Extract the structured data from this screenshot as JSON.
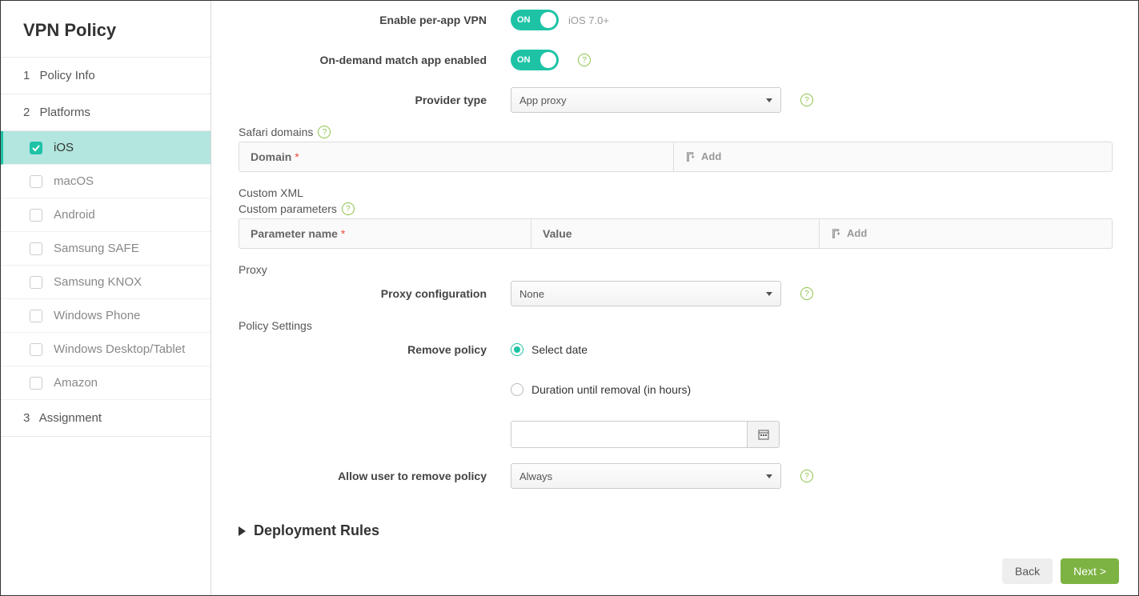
{
  "sidebar": {
    "title": "VPN Policy",
    "steps": [
      {
        "num": "1",
        "label": "Policy Info"
      },
      {
        "num": "2",
        "label": "Platforms"
      },
      {
        "num": "3",
        "label": "Assignment"
      }
    ],
    "platforms": [
      {
        "label": "iOS",
        "active": true
      },
      {
        "label": "macOS",
        "active": false
      },
      {
        "label": "Android",
        "active": false
      },
      {
        "label": "Samsung SAFE",
        "active": false
      },
      {
        "label": "Samsung KNOX",
        "active": false
      },
      {
        "label": "Windows Phone",
        "active": false
      },
      {
        "label": "Windows Desktop/Tablet",
        "active": false
      },
      {
        "label": "Amazon",
        "active": false
      }
    ]
  },
  "form": {
    "enable_per_app_vpn": {
      "label": "Enable per-app VPN",
      "toggle": "ON",
      "hint": "iOS 7.0+"
    },
    "on_demand_match": {
      "label": "On-demand match app enabled",
      "toggle": "ON"
    },
    "provider_type": {
      "label": "Provider type",
      "value": "App proxy"
    },
    "safari_domains": {
      "label": "Safari domains",
      "col_domain": "Domain",
      "add": "Add"
    },
    "custom_xml": {
      "label": "Custom XML"
    },
    "custom_params": {
      "label": "Custom parameters",
      "col_param": "Parameter name",
      "col_value": "Value",
      "add": "Add"
    },
    "proxy": {
      "label": "Proxy"
    },
    "proxy_config": {
      "label": "Proxy configuration",
      "value": "None"
    },
    "policy_settings": {
      "label": "Policy Settings"
    },
    "remove_policy": {
      "label": "Remove policy",
      "opt1": "Select date",
      "opt2": "Duration until removal (in hours)"
    },
    "date_value": "",
    "allow_remove": {
      "label": "Allow user to remove policy",
      "value": "Always"
    },
    "deployment_rules": "Deployment Rules"
  },
  "footer": {
    "back": "Back",
    "next": "Next >"
  }
}
